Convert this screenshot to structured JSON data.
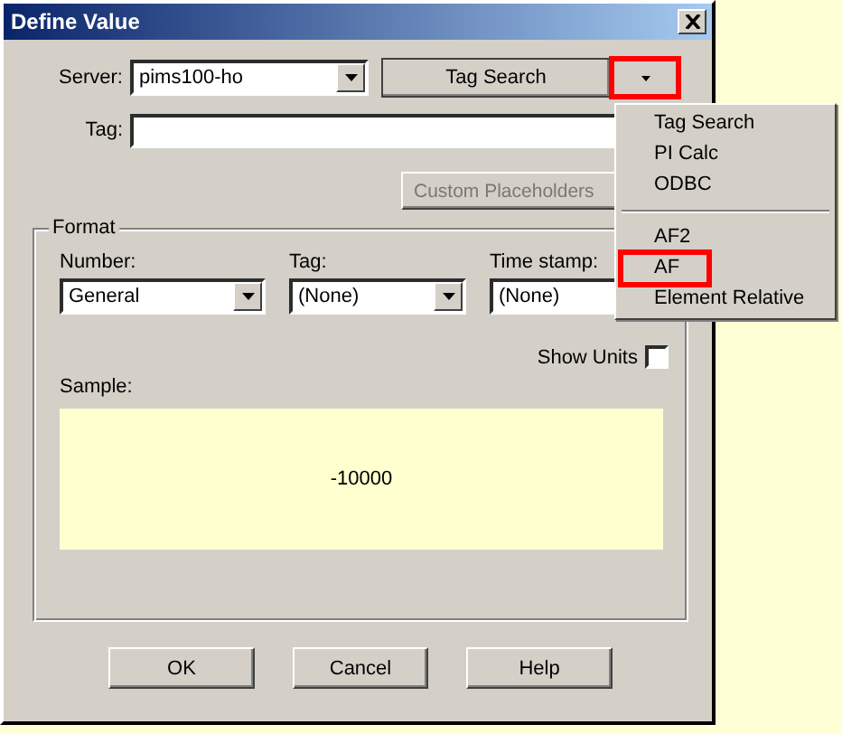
{
  "window": {
    "title": "Define Value"
  },
  "server": {
    "label": "Server:",
    "value": "pims100-ho"
  },
  "tag_search_button": {
    "label": "Tag Search"
  },
  "menu_button": {
    "highlighted": true
  },
  "tag": {
    "label": "Tag:"
  },
  "custom_placeholders_button": {
    "label": "Custom Placeholders",
    "disabled": true
  },
  "format": {
    "title": "Format",
    "fields": [
      {
        "label": "Number:",
        "value": "General"
      },
      {
        "label": "Tag:",
        "value": "(None)"
      },
      {
        "label": "Time stamp:",
        "value": "(None)"
      }
    ],
    "show_units": {
      "label": "Show Units",
      "checked": false
    },
    "sample": {
      "label": "Sample:",
      "value": "-10000"
    }
  },
  "buttons": [
    "OK",
    "Cancel",
    "Help"
  ],
  "menu": {
    "items": [
      {
        "kind": "item",
        "label": "Tag Search",
        "highlighted": false
      },
      {
        "kind": "item",
        "label": "PI Calc",
        "highlighted": false
      },
      {
        "kind": "item",
        "label": "ODBC",
        "highlighted": false
      },
      {
        "kind": "separator"
      },
      {
        "kind": "item",
        "label": "AF2",
        "highlighted": false
      },
      {
        "kind": "item",
        "label": "AF",
        "highlighted": true
      },
      {
        "kind": "item",
        "label": "Element Relative",
        "highlighted": false
      }
    ]
  }
}
